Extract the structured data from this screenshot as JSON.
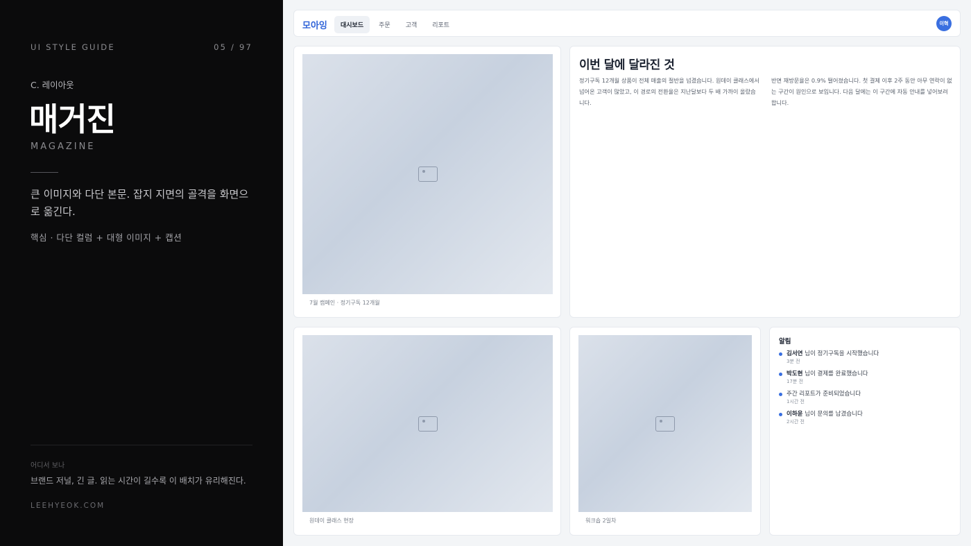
{
  "guide": {
    "label": "UI STYLE GUIDE",
    "pager": "05 / 97",
    "section": "C. 레이아웃",
    "title": "매거진",
    "title_en": "MAGAZINE",
    "description": "큰 이미지와 다단 본문. 잡지 지면의 골격을 화면으로 옮긴다.",
    "formula": "핵심 · 다단 컬럼 + 대형 이미지 + 캡션",
    "where_label": "어디서 보나",
    "where_text": "브랜드 저널, 긴 글. 읽는 시간이 길수록 이 배치가 유리해진다.",
    "site": "LEEHYEOK.COM"
  },
  "app": {
    "logo": "모아잉",
    "nav": [
      "대시보드",
      "주문",
      "고객",
      "리포트"
    ],
    "active_nav": "대시보드",
    "avatar": "이혁"
  },
  "feature": {
    "caption": "7월 캠페인 · 정기구독 12개월"
  },
  "article": {
    "title": "이번 달에 달라진 것",
    "col1": "정기구독 12개월 상품이 전체 매출의 절반을 넘겼습니다. 원데이 클래스에서 넘어온 고객이 많았고, 이 경로의 전환율은 지난달보다 두 배 가까이 올랐습니다.",
    "col2": "반면 재방문율은 0.9% 떨어졌습니다. 첫 결제 이후 2주 동안 아무 연락이 없는 구간이 원인으로 보입니다. 다음 달에는 이 구간에 자동 안내를 넣어보려 합니다."
  },
  "gallery": {
    "caption1": "원데이 클래스 현장",
    "caption2": "워크숍 2일차"
  },
  "notifications": {
    "title": "알림",
    "items": [
      {
        "name": "김서연",
        "text": " 님이 정기구독을 시작했습니다",
        "time": "3분 전"
      },
      {
        "name": "박도현",
        "text": " 님이 결제를 완료했습니다",
        "time": "17분 전"
      },
      {
        "name": "",
        "text": "주간 리포트가 준비되었습니다",
        "time": "1시간 전"
      },
      {
        "name": "이하윤",
        "text": " 님이 문의를 남겼습니다",
        "time": "2시간 전"
      }
    ]
  },
  "colors": {
    "accent": "#3a6fe0",
    "left_bg": "#0b0b0c",
    "page_bg": "#f3f5f7"
  },
  "icons": {
    "image_placeholder": "image-icon",
    "notification_bullet": "dot-icon"
  }
}
